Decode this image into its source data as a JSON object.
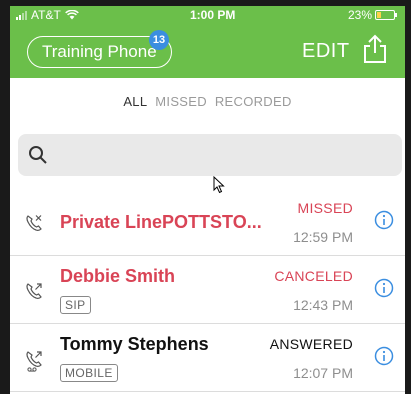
{
  "status_bar": {
    "carrier": "AT&T",
    "time": "1:00 PM",
    "battery": "23%"
  },
  "header": {
    "account_label": "Training Phone",
    "badge_count": "13",
    "edit_label": "EDIT"
  },
  "filters": {
    "all": "ALL",
    "missed": "MISSED",
    "recorded": "RECORDED"
  },
  "search": {
    "placeholder": ""
  },
  "colors": {
    "header_green": "#6bbf4a",
    "missed_red": "#d94456",
    "info_blue": "#3b8ee0"
  },
  "calls": [
    {
      "name": "Private LinePOTTSTO...",
      "tag": "",
      "status": "MISSED",
      "time": "12:59 PM",
      "icon": "missed-call-icon"
    },
    {
      "name": "Debbie Smith",
      "tag": "SIP",
      "status": "CANCELED",
      "time": "12:43 PM",
      "icon": "outgoing-call-icon"
    },
    {
      "name": "Tommy Stephens",
      "tag": "MOBILE",
      "status": "ANSWERED",
      "time": "12:07 PM",
      "icon": "voicemail-call-icon"
    }
  ]
}
